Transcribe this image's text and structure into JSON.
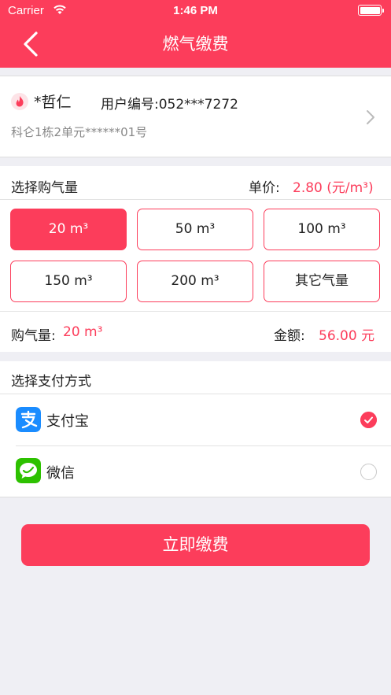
{
  "status_bar": {
    "carrier": "Carrier",
    "time": "1:46 PM"
  },
  "nav": {
    "title": "燃气缴费"
  },
  "user": {
    "name": "*哲仁",
    "id_text": "用户编号:052***7272",
    "address": "科仑1栋2单元******01号"
  },
  "gas": {
    "section_title": "选择购气量",
    "unit_price_label": "单价:",
    "unit_price_value": "2.80 (元/m³)",
    "options": [
      {
        "label": "20 m³",
        "selected": true
      },
      {
        "label": "50 m³",
        "selected": false
      },
      {
        "label": "100 m³",
        "selected": false
      },
      {
        "label": "150 m³",
        "selected": false
      },
      {
        "label": "200 m³",
        "selected": false
      },
      {
        "label": "其它气量",
        "selected": false
      }
    ],
    "quantity_label": "购气量:",
    "quantity_value": "20 m³",
    "amount_label": "金额:",
    "amount_value": "56.00 元"
  },
  "payment": {
    "section_title": "选择支付方式",
    "methods": [
      {
        "name": "支付宝",
        "selected": true,
        "icon": "alipay-icon"
      },
      {
        "name": "微信",
        "selected": false,
        "icon": "wechat-icon"
      }
    ]
  },
  "action": {
    "pay_label": "立即缴费"
  },
  "colors": {
    "accent": "#fc3d5b",
    "alipay": "#1a8cff",
    "wechat": "#2dc100",
    "background": "#efeff4"
  }
}
